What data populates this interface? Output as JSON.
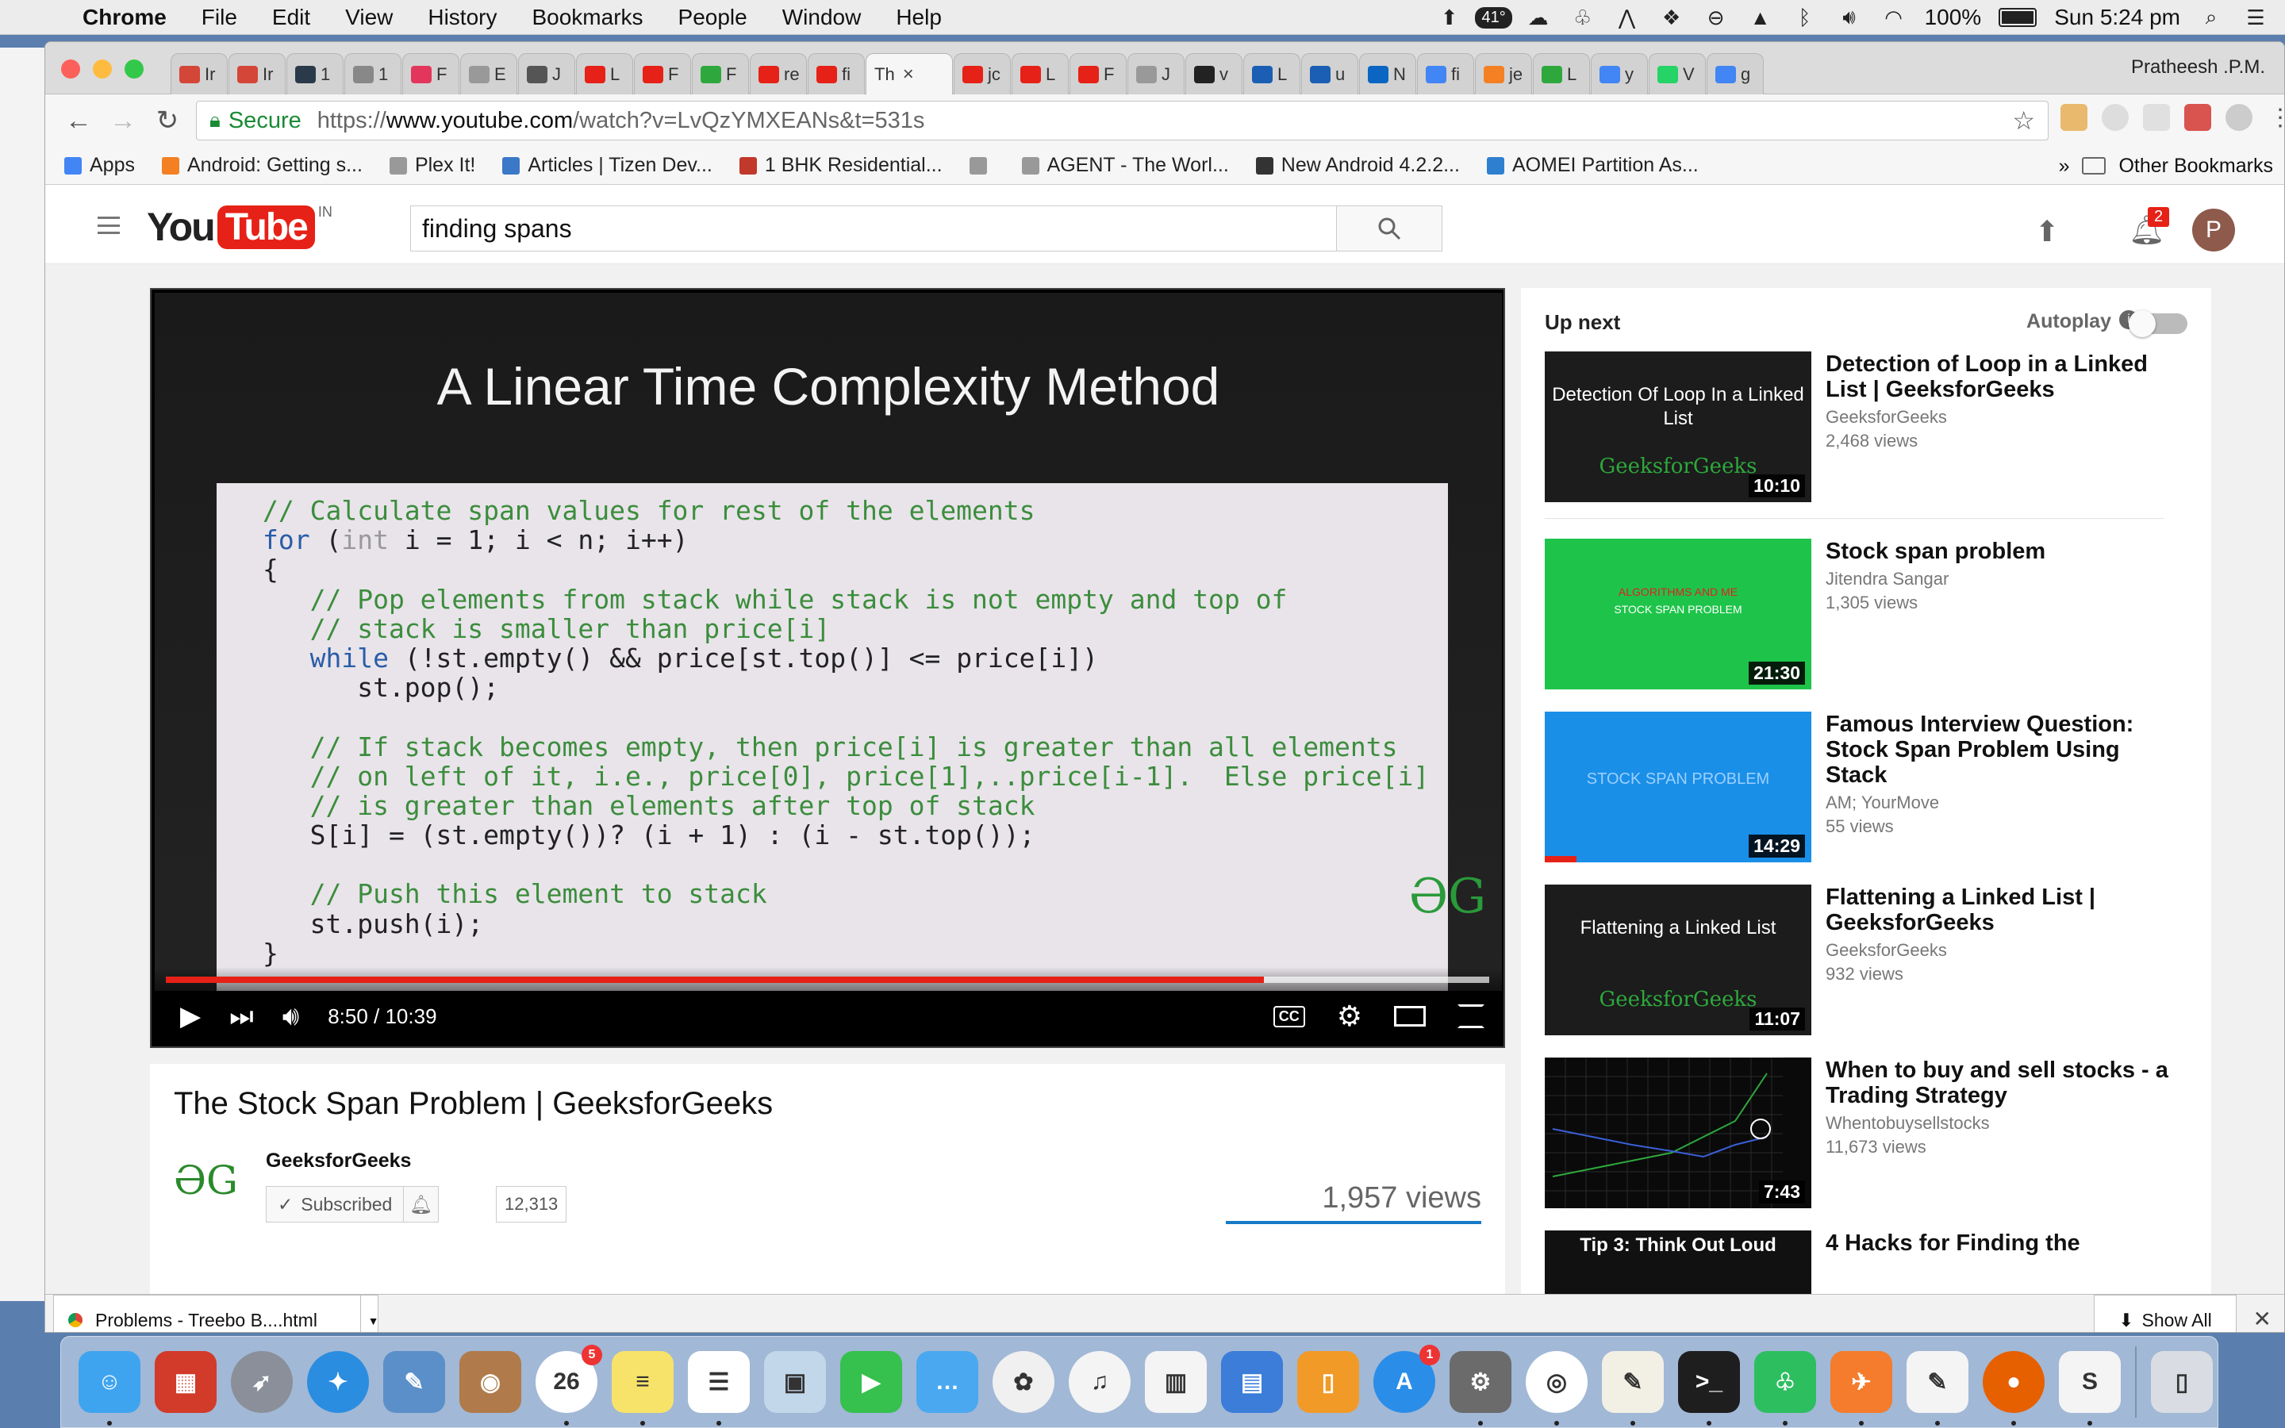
{
  "menubar": {
    "app_name": "Chrome",
    "items": [
      "File",
      "Edit",
      "View",
      "History",
      "Bookmarks",
      "People",
      "Window",
      "Help"
    ],
    "temperature": "41°",
    "battery": "100%",
    "clock": "Sun 5:24 pm"
  },
  "browser": {
    "profile": "Pratheesh .P.M.",
    "tabs": [
      {
        "label": "Ir",
        "icon": "gmail-icon",
        "color": "#d44638"
      },
      {
        "label": "Ir",
        "icon": "gmail-icon",
        "color": "#d44638"
      },
      {
        "label": "1",
        "icon": "hackerrank-icon",
        "color": "#2b3a4a"
      },
      {
        "label": "1",
        "icon": "medium-icon",
        "color": "#888888"
      },
      {
        "label": "F",
        "icon": "myntra-icon",
        "color": "#e2365c"
      },
      {
        "label": "E",
        "icon": "page-icon",
        "color": "#999999"
      },
      {
        "label": "J",
        "icon": "code-icon",
        "color": "#555555"
      },
      {
        "label": "L",
        "icon": "youtube-icon",
        "color": "#e62117"
      },
      {
        "label": "F",
        "icon": "youtube-icon",
        "color": "#e62117"
      },
      {
        "label": "F",
        "icon": "gfg-icon",
        "color": "#2ea83d"
      },
      {
        "label": "re",
        "icon": "youtube-icon",
        "color": "#e62117"
      },
      {
        "label": "fi",
        "icon": "youtube-icon",
        "color": "#e62117"
      },
      {
        "label": "Th",
        "icon": "none",
        "color": "#f6f6f6",
        "active": true
      },
      {
        "label": "jc",
        "icon": "youtube-icon",
        "color": "#e62117"
      },
      {
        "label": "L",
        "icon": "youtube-icon",
        "color": "#e62117"
      },
      {
        "label": "F",
        "icon": "youtube-icon",
        "color": "#e62117"
      },
      {
        "label": "J",
        "icon": "page-icon",
        "color": "#999999"
      },
      {
        "label": "v",
        "icon": "github-icon",
        "color": "#222222"
      },
      {
        "label": "L",
        "icon": "underline-icon",
        "color": "#1a5fb4"
      },
      {
        "label": "u",
        "icon": "underline-icon",
        "color": "#1a5fb4"
      },
      {
        "label": "N",
        "icon": "linkedin-icon",
        "color": "#0a66c2"
      },
      {
        "label": "fi",
        "icon": "google-icon",
        "color": "#4285f4"
      },
      {
        "label": "je",
        "icon": "stackoverflow-icon",
        "color": "#f48024"
      },
      {
        "label": "L",
        "icon": "gfg-icon",
        "color": "#2ea83d"
      },
      {
        "label": "y",
        "icon": "google-icon",
        "color": "#4285f4"
      },
      {
        "label": "V",
        "icon": "whatsapp-icon",
        "color": "#25d366"
      },
      {
        "label": "g",
        "icon": "google-icon",
        "color": "#4285f4"
      }
    ],
    "omnibox": {
      "secure_label": "Secure",
      "url_scheme": "https://",
      "url_domain": "www.youtube.com",
      "url_path": "/watch?v=LvQzYMXEANs&t=531s"
    },
    "bookmarks": [
      {
        "label": "Apps",
        "icon": "apps-grid-icon",
        "color": "#4285f4"
      },
      {
        "label": "Android: Getting s...",
        "icon": "stackoverflow-icon",
        "color": "#f48024"
      },
      {
        "label": "Plex It!",
        "icon": "page-icon",
        "color": "#999999"
      },
      {
        "label": "Articles | Tizen Dev...",
        "icon": "tizen-icon",
        "color": "#3b78c8"
      },
      {
        "label": "1 BHK Residential...",
        "icon": "house-icon",
        "color": "#c0392b"
      },
      {
        "label": "",
        "icon": "page-icon",
        "color": "#999999"
      },
      {
        "label": "AGENT - The Worl...",
        "icon": "page-icon",
        "color": "#999999"
      },
      {
        "label": "New Android 4.2.2...",
        "icon": "bird-icon",
        "color": "#333333"
      },
      {
        "label": "AOMEI Partition As...",
        "icon": "aomei-icon",
        "color": "#2f7fd0"
      }
    ],
    "other_bookmarks": "Other Bookmarks",
    "downloads": {
      "file": "Problems - Treebo B....html",
      "show_all": "Show All"
    }
  },
  "youtube": {
    "search_query": "finding spans",
    "notification_count": "2",
    "avatar_letter": "P",
    "logo_region": "IN",
    "player": {
      "slide_title": "A Linear Time Complexity Method",
      "code_lines": [
        {
          "text": "// Calculate span values for rest of the elements",
          "kind": "comment"
        },
        {
          "text": "for (int i = 1; i < n; i++)",
          "kind": "for"
        },
        {
          "text": "{",
          "kind": "plain"
        },
        {
          "text": "   // Pop elements from stack while stack is not empty and top of",
          "kind": "comment"
        },
        {
          "text": "   // stack is smaller than price[i]",
          "kind": "comment"
        },
        {
          "text": "   while (!st.empty() && price[st.top()] <= price[i])",
          "kind": "while"
        },
        {
          "text": "      st.pop();",
          "kind": "plain"
        },
        {
          "text": "",
          "kind": "plain"
        },
        {
          "text": "   // If stack becomes empty, then price[i] is greater than all elements",
          "kind": "comment"
        },
        {
          "text": "   // on left of it, i.e., price[0], price[1],..price[i-1].  Else price[i]",
          "kind": "comment"
        },
        {
          "text": "   // is greater than elements after top of stack",
          "kind": "comment"
        },
        {
          "text": "   S[i] = (st.empty())? (i + 1) : (i - st.top());",
          "kind": "plain"
        },
        {
          "text": "",
          "kind": "plain"
        },
        {
          "text": "   // Push this element to stack",
          "kind": "comment"
        },
        {
          "text": "   st.push(i);",
          "kind": "plain"
        },
        {
          "text": "}",
          "kind": "plain"
        }
      ],
      "watermark": "ƏG",
      "current_time": "8:50",
      "duration": "10:39",
      "time_display": "8:50 / 10:39",
      "played_fraction": 0.83,
      "buffered_fraction": 1.0,
      "cc_label": "CC"
    },
    "video": {
      "title": "The Stock Span Problem | GeeksforGeeks",
      "channel": "GeeksforGeeks",
      "channel_logo": "ƏG",
      "subscribed_label": "Subscribed",
      "subscriber_count": "12,313",
      "views": "1,957 views"
    },
    "sidebar": {
      "up_next": "Up next",
      "autoplay": "Autoplay",
      "recommendations": [
        {
          "title": "Detection of Loop in a Linked List | GeeksforGeeks",
          "channel": "GeeksforGeeks",
          "views": "2,468 views",
          "duration": "10:10",
          "thumb_text": "Detection Of Loop In a Linked List",
          "thumb_brand": "GeeksforGeeks",
          "thumb_bg": "#1c1c1c"
        },
        {
          "title": "Stock span problem",
          "channel": "Jitendra Sangar",
          "views": "1,305 views",
          "duration": "21:30",
          "thumb_text": "ALGORITHMS AND ME",
          "thumb_subtext": "STOCK SPAN PROBLEM",
          "thumb_bg": "#1ec44a"
        },
        {
          "title": "Famous Interview Question: Stock Span Problem Using Stack",
          "channel": "AM; YourMove",
          "views": "55 views",
          "duration": "14:29",
          "thumb_text": "STOCK SPAN PROBLEM",
          "thumb_bg": "#1a8fe8"
        },
        {
          "title": "Flattening a Linked List | GeeksforGeeks",
          "channel": "GeeksforGeeks",
          "views": "932 views",
          "duration": "11:07",
          "thumb_text": "Flattening a Linked List",
          "thumb_brand": "GeeksforGeeks",
          "thumb_bg": "#1c1c1c"
        },
        {
          "title": "When to buy and sell stocks - a Trading Strategy",
          "channel": "Whentobuysellstocks",
          "views": "11,673 views",
          "duration": "7:43",
          "thumb_bg": "#0a0a0a"
        },
        {
          "title": "4 Hacks for Finding the",
          "channel": "",
          "views": "",
          "duration": "",
          "thumb_text": "Tip 3: Think Out Loud",
          "thumb_bg": "#111111"
        }
      ]
    }
  },
  "dock": [
    {
      "name": "finder-icon",
      "color": "#3fa4f0",
      "glyph": "☺"
    },
    {
      "name": "antivirus-icon",
      "color": "#d23a2a",
      "glyph": "▦"
    },
    {
      "name": "launchpad-icon",
      "color": "#8a8f99",
      "glyph": "➶"
    },
    {
      "name": "safari-icon",
      "color": "#2a8de0",
      "glyph": "✦"
    },
    {
      "name": "preview-icon",
      "color": "#5b8fc9",
      "glyph": "✎"
    },
    {
      "name": "contacts-icon",
      "color": "#b07a4a",
      "glyph": "◉"
    },
    {
      "name": "calendar-icon",
      "color": "#ffffff",
      "glyph": "26",
      "badge": "5"
    },
    {
      "name": "notes-icon",
      "color": "#f7e36a",
      "glyph": "≡"
    },
    {
      "name": "reminders-icon",
      "color": "#ffffff",
      "glyph": "☰"
    },
    {
      "name": "photo-booth-icon",
      "color": "#c3d7ea",
      "glyph": "▣"
    },
    {
      "name": "facetime-icon",
      "color": "#36c04e",
      "glyph": "▶"
    },
    {
      "name": "messages-icon",
      "color": "#4aa8f0",
      "glyph": "…"
    },
    {
      "name": "photos-icon",
      "color": "#f0f0f0",
      "glyph": "✿"
    },
    {
      "name": "itunes-icon",
      "color": "#f4f4f4",
      "glyph": "♫"
    },
    {
      "name": "numbers-icon",
      "color": "#f4f4f4",
      "glyph": "▥"
    },
    {
      "name": "keynote-icon",
      "color": "#3b7dd8",
      "glyph": "▤"
    },
    {
      "name": "ibooks-icon",
      "color": "#f29a28",
      "glyph": "▯"
    },
    {
      "name": "app-store-icon",
      "color": "#2a8de8",
      "glyph": "A",
      "badge": "1"
    },
    {
      "name": "system-preferences-icon",
      "color": "#6b6b6b",
      "glyph": "⚙"
    },
    {
      "name": "chrome-icon",
      "color": "#ffffff",
      "glyph": "◎"
    },
    {
      "name": "textedit-icon",
      "color": "#f2efe4",
      "glyph": "✎"
    },
    {
      "name": "terminal-icon",
      "color": "#1e1e1e",
      "glyph": ">_"
    },
    {
      "name": "evernote-icon",
      "color": "#2dbe60",
      "glyph": "♧"
    },
    {
      "name": "postman-icon",
      "color": "#f47c2c",
      "glyph": "✈"
    },
    {
      "name": "pages-icon",
      "color": "#f4f4f4",
      "glyph": "✎"
    },
    {
      "name": "firefox-icon",
      "color": "#e66000",
      "glyph": "●"
    },
    {
      "name": "slack-icon",
      "color": "#f4f4f4",
      "glyph": "S"
    },
    {
      "name": "trash-icon",
      "color": "#d9dde3",
      "glyph": "▯"
    }
  ]
}
